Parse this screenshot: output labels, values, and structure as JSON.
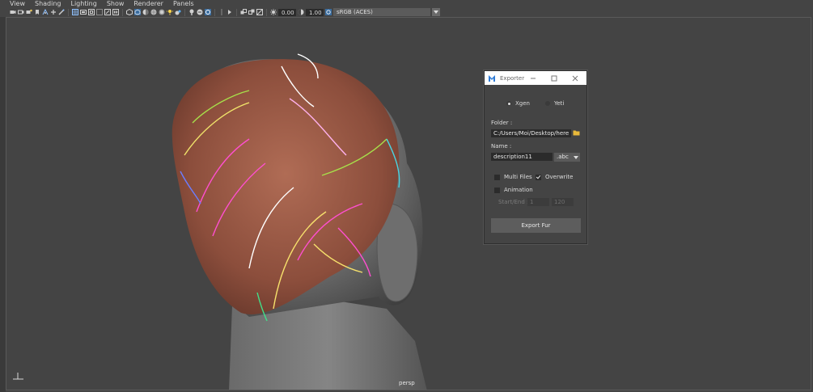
{
  "menubar": {
    "items": [
      "View",
      "Shading",
      "Lighting",
      "Show",
      "Renderer",
      "Panels"
    ]
  },
  "toolbar": {
    "exposure_value": "0.00",
    "gamma_value": "1.00",
    "colorspace": "sRGB (ACES)",
    "icons": [
      "camera-icon",
      "camera-attributes-icon",
      "bookmark-icon",
      "image-plane-icon",
      "grid-icon",
      "film-gate-icon",
      "resolution-gate-icon",
      "gate-mask-icon",
      "field-chart-icon",
      "safe-action-icon",
      "wireframe-icon",
      "smooth-shade-icon",
      "default-material-icon",
      "textured-icon",
      "use-all-lights-icon",
      "shadows-icon",
      "screen-space-ao-icon",
      "motion-blur-icon",
      "anti-aliasing-icon",
      "depth-of-field-icon",
      "isolate-select-icon",
      "xray-icon",
      "xray-joints-icon",
      "backface-culling-icon",
      "exposure-icon",
      "gamma-icon",
      "color-management-icon"
    ]
  },
  "viewport": {
    "camera_label": "persp"
  },
  "colors": {
    "ui_background": "#444444",
    "field_background": "#2b2b2b",
    "titlebar": "#ffffff",
    "logo_blue": "#2e7bd6",
    "folder_yellow": "#e8b93a"
  },
  "exporter": {
    "title": "Exporter",
    "radio_xgen": "Xgen",
    "radio_yeti": "Yeti",
    "selected_mode": "Xgen",
    "folder_label": "Folder :",
    "folder_value": "C:/Users/Moi/Desktop/here",
    "name_label": "Name :",
    "name_value": "description11",
    "extension": ".abc",
    "multi_files_label": "Multi Files",
    "multi_files_checked": false,
    "overwrite_label": "Overwrite",
    "overwrite_checked": true,
    "animation_label": "Animation",
    "animation_checked": false,
    "start_end_label": "Start/End :",
    "start_value": "1",
    "end_value": "120",
    "export_button": "Export Fur"
  }
}
